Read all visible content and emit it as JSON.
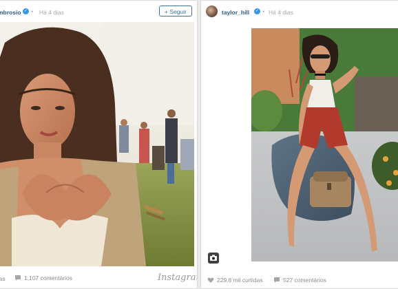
{
  "posts": [
    {
      "username": "alessandraambrosio",
      "username_visible": "mbrosio",
      "time": "Há 4 dias",
      "follow_label": "+ Seguir",
      "likes_label": "das",
      "comments_label": "1,107 comentários",
      "brand": "Instagram"
    },
    {
      "username": "taylor_hill",
      "time": "Há 4 dias",
      "likes_label": "229.6 mil curtidas",
      "comments_label": "527 comentários"
    }
  ],
  "icons": {
    "verified": "verified-badge-icon",
    "heart": "heart-icon",
    "comment": "comment-bubble-icon",
    "camera": "camera-icon"
  },
  "colors": {
    "username": "#2f5d86",
    "follow_border": "#3f729b",
    "verified": "#3897f0",
    "meta_text": "#8a8a8a"
  }
}
